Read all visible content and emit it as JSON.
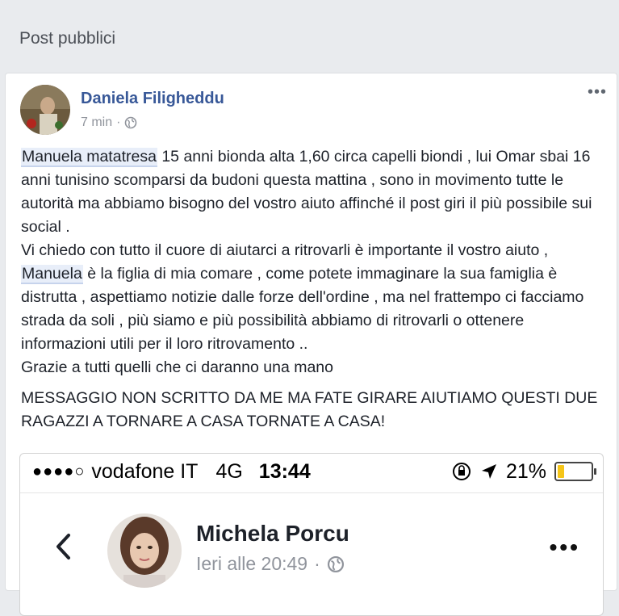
{
  "section": {
    "title": "Post pubblici"
  },
  "post": {
    "author": "Daniela Filigheddu",
    "time": "7 min",
    "time_separator": "·",
    "privacy_icon": "globe-icon",
    "more_label": "•••",
    "paragraph1": {
      "tag": "Manuela matatresa",
      "text": " 15 anni bionda alta 1,60 circa capelli biondi , lui Omar sbai 16 anni tunisino scomparsi da budoni questa mattina , sono in movimento tutte le autorità ma abbiamo bisogno del vostro aiuto affinché il post giri il più possibile sui social ."
    },
    "paragraph2": {
      "intro": "Vi chiedo con tutto il cuore di aiutarci a ritrovarli è importante il vostro aiuto , ",
      "tag": "Manuela",
      "text": " è la figlia di mia comare , come potete immaginare la sua famiglia è distrutta , aspettiamo notizie dalle forze dell'ordine , ma nel frattempo ci facciamo strada da soli , più siamo e più possibilità abbiamo di ritrovarli o ottenere informazioni utili per il loro ritrovamento .."
    },
    "paragraph3": "Grazie a tutti quelli che ci daranno una mano",
    "paragraph4": "MESSAGGIO NON SCRITTO DA ME MA FATE GIRARE AIUTIAMO QUESTI DUE RAGAZZI A TORNARE A CASA TORNATE A CASA!"
  },
  "screenshot": {
    "signal": "●●●●○",
    "carrier": "vodafone IT",
    "network": "4G",
    "time": "13:44",
    "battery": "21%",
    "battery_level": 0.21,
    "back_icon": "chevron-left-icon",
    "name": "Michela Porcu",
    "timestamp": "Ieri alle 20:49",
    "timestamp_separator": "·",
    "more_label": "•••"
  }
}
